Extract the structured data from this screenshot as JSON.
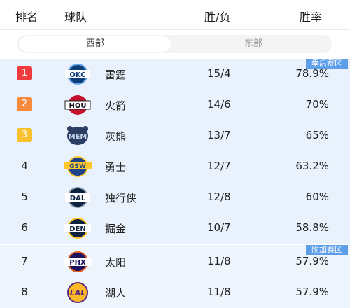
{
  "header": {
    "rank": "排名",
    "team": "球队",
    "record": "胜/负",
    "pct": "胜率"
  },
  "tabs": {
    "west": "西部",
    "east": "东部",
    "active": "西部"
  },
  "zones": {
    "playoff": "季后赛区",
    "playin": "附加赛区"
  },
  "badge_colors": {
    "1": "#ef3b3b",
    "2": "#f78a3c",
    "3": "#f9c12e"
  },
  "standings": [
    {
      "rank": "1",
      "team": "雷霆",
      "abbr": "OKC",
      "record": "15/4",
      "pct": "78.9%"
    },
    {
      "rank": "2",
      "team": "火箭",
      "abbr": "HOU",
      "record": "14/6",
      "pct": "70%"
    },
    {
      "rank": "3",
      "team": "灰熊",
      "abbr": "MEM",
      "record": "13/7",
      "pct": "65%"
    },
    {
      "rank": "4",
      "team": "勇士",
      "abbr": "GSW",
      "record": "12/7",
      "pct": "63.2%"
    },
    {
      "rank": "5",
      "team": "独行侠",
      "abbr": "DAL",
      "record": "12/8",
      "pct": "60%"
    },
    {
      "rank": "6",
      "team": "掘金",
      "abbr": "DEN",
      "record": "10/7",
      "pct": "58.8%"
    },
    {
      "rank": "7",
      "team": "太阳",
      "abbr": "PHX",
      "record": "11/8",
      "pct": "57.9%"
    },
    {
      "rank": "8",
      "team": "湖人",
      "abbr": "LAL",
      "record": "11/8",
      "pct": "57.9%"
    }
  ]
}
